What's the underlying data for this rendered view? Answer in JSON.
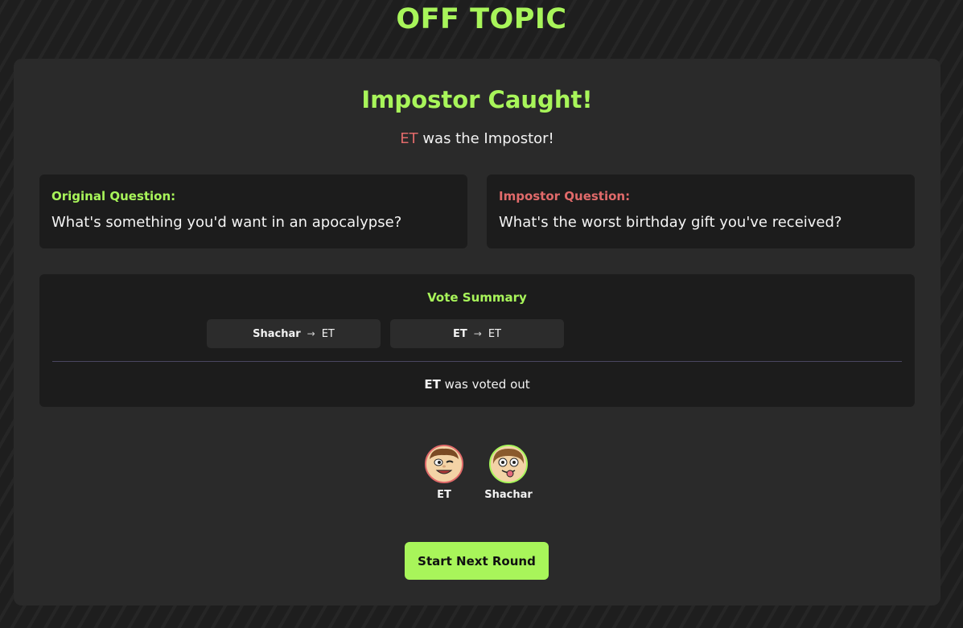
{
  "app": {
    "title": "OFF TOPIC"
  },
  "result": {
    "title": "Impostor Caught!",
    "impostor_name": "ET",
    "impostor_suffix": " was the Impostor!"
  },
  "questions": {
    "original": {
      "label": "Original Question:",
      "text": "What's something you'd want in an apocalypse?"
    },
    "impostor": {
      "label": "Impostor Question:",
      "text": "What's the worst birthday gift you've received?"
    }
  },
  "vote_summary": {
    "title": "Vote Summary",
    "arrow": "→",
    "votes": [
      {
        "voter": "Shachar",
        "target": "ET"
      },
      {
        "voter": "ET",
        "target": "ET"
      }
    ],
    "voted_out_name": "ET",
    "voted_out_suffix": " was voted out"
  },
  "players": [
    {
      "name": "ET",
      "icon": "winking-face-avatar-icon",
      "ring_color": "#e16a6a"
    },
    {
      "name": "Shachar",
      "icon": "tongue-out-face-avatar-icon",
      "ring_color": "#a8f55a"
    }
  ],
  "actions": {
    "next_round_label": "Start Next Round"
  },
  "colors": {
    "accent": "#a8f55a",
    "impostor": "#e16a6a",
    "panel": "#2a2a2a",
    "card": "#1c1c1c"
  }
}
